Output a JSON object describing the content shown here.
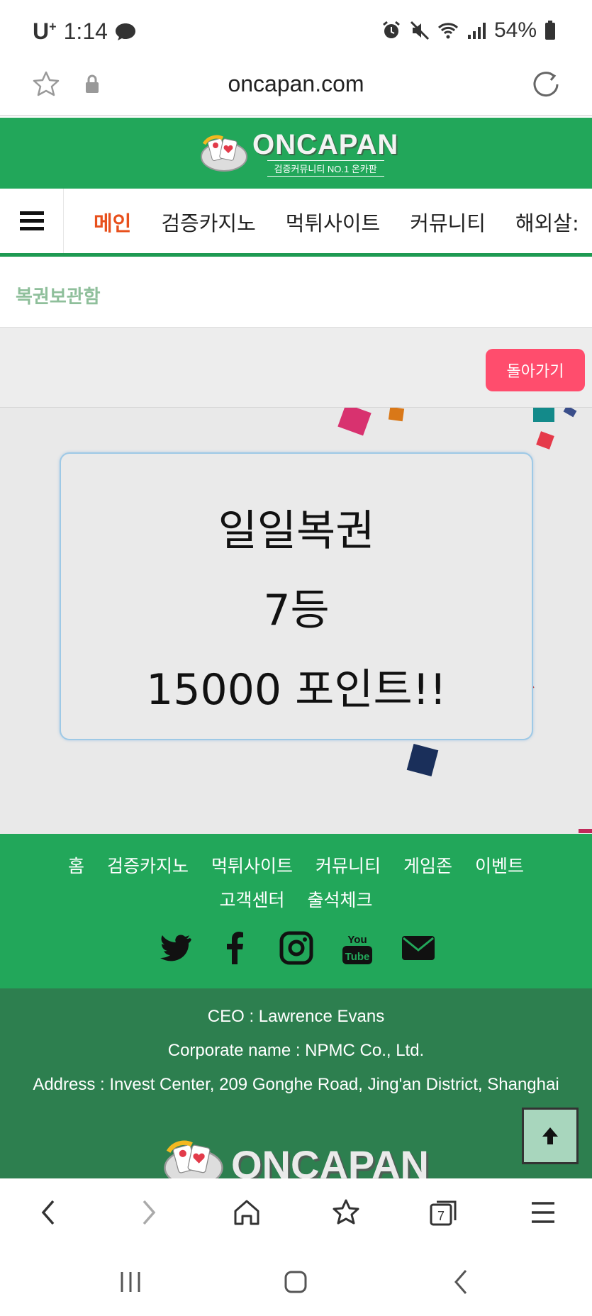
{
  "status_bar": {
    "carrier": "U",
    "carrier_sup": "+",
    "time": "1:14",
    "battery": "54%"
  },
  "browser": {
    "url": "oncapan.com",
    "tab_count": "7"
  },
  "site": {
    "logo_title": "ONCAPAN",
    "logo_subtitle": "검증커뮤니티 NO.1 온카판",
    "nav": [
      "메인",
      "검증카지노",
      "먹튀사이트",
      "커뮤니티",
      "해외살:"
    ],
    "section_title": "복권보관함",
    "back_button": "돌아가기"
  },
  "result": {
    "line1": "일일복권",
    "line2": "7등",
    "line3": "15000 포인트!!"
  },
  "footer": {
    "links_row1": [
      "홈",
      "검증카지노",
      "먹튀사이트",
      "커뮤니티",
      "게임존",
      "이벤트"
    ],
    "links_row2": [
      "고객센터",
      "출석체크"
    ],
    "social_icons": [
      "twitter-icon",
      "facebook-icon",
      "instagram-icon",
      "youtube-icon",
      "email-icon"
    ],
    "ceo": "CEO : Lawrence Evans",
    "corporate": "Corporate name : NPMC Co., Ltd.",
    "address": "Address : Invest Center, 209 Gonghe Road, Jing'an District, Shanghai",
    "logo_title": "ONCAPAN"
  },
  "colors": {
    "brand_green": "#22a75a",
    "footer_dark_green": "#2d7f4f",
    "nav_active": "#e8501c",
    "back_button": "#ff4d6d"
  }
}
